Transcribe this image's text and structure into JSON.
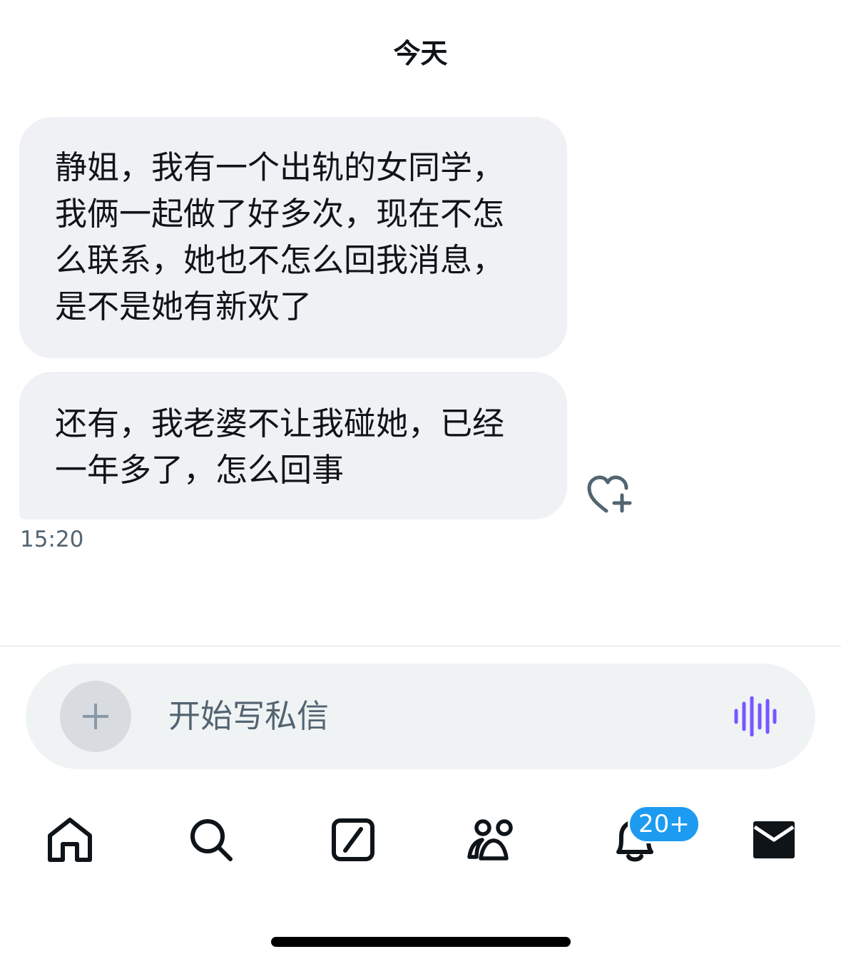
{
  "header": {
    "date_label": "今天"
  },
  "messages": [
    {
      "text": "静姐，我有一个出轨的女同学，\n我俩一起做了好多次，现在不怎\n么联系，她也不怎么回我消息，\n是不是她有新欢了"
    },
    {
      "text": "还有，我老婆不让我碰她，已经\n一年多了，怎么回事"
    }
  ],
  "message_time": "15:20",
  "composer": {
    "placeholder": "开始写私信"
  },
  "tabbar": {
    "tabs": [
      "home-icon",
      "search-icon",
      "compose-icon",
      "communities-icon",
      "notifications-icon",
      "messages-icon"
    ],
    "notifications_badge": "20+"
  },
  "colors": {
    "bubble_bg": "#eff1f4",
    "text": "#0f1419",
    "muted": "#536471",
    "accent_blue": "#1d9bf0",
    "voice_purple": "#7856ff"
  }
}
